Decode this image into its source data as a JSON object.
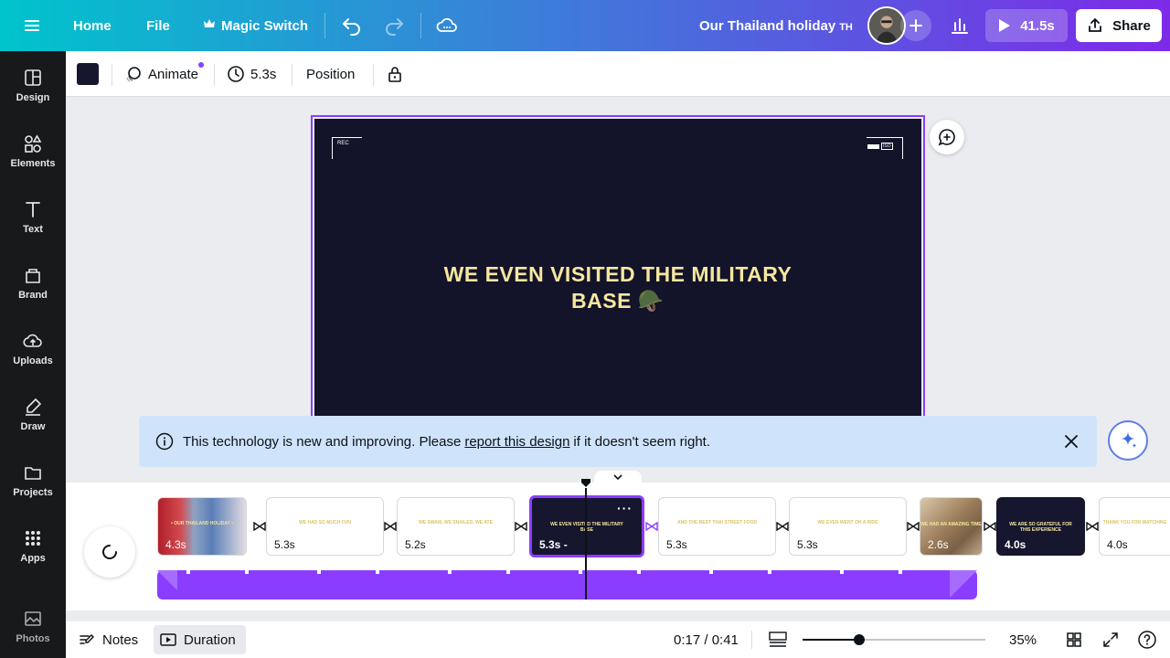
{
  "topbar": {
    "home_label": "Home",
    "file_label": "File",
    "magic_switch_label": "Magic Switch",
    "doc_title": "Our Thailand holiday",
    "doc_title_suffix": "TH",
    "play_label": "41.5s",
    "share_label": "Share"
  },
  "sidebar": {
    "items": [
      {
        "label": "Design",
        "icon": "design-icon"
      },
      {
        "label": "Elements",
        "icon": "elements-icon"
      },
      {
        "label": "Text",
        "icon": "text-icon"
      },
      {
        "label": "Brand",
        "icon": "brand-icon"
      },
      {
        "label": "Uploads",
        "icon": "uploads-icon"
      },
      {
        "label": "Draw",
        "icon": "draw-icon"
      },
      {
        "label": "Projects",
        "icon": "projects-icon"
      },
      {
        "label": "Apps",
        "icon": "apps-icon"
      },
      {
        "label": "Photos",
        "icon": "photos-icon"
      }
    ]
  },
  "context_toolbar": {
    "color_swatch": "#16172e",
    "animate_label": "Animate",
    "duration_label": "5.3s",
    "position_label": "Position"
  },
  "canvas": {
    "rec_label": "REC",
    "iso_label": "ISO",
    "slide_text_line1": "WE EVEN VISITED THE MILITARY",
    "slide_text_line2": "BASE 🪖",
    "text_color": "#f5e79e",
    "bg_color": "#13132a"
  },
  "banner": {
    "text_before": "This technology is new and improving. Please",
    "link_text": "report this design",
    "text_after": "if it doesn't seem right."
  },
  "timeline": {
    "pages": [
      {
        "duration": "4.3s",
        "mini": "• OUR THAILAND HOLIDAY •"
      },
      {
        "duration": "5.3s",
        "mini": "WE HAD SO MUCH FUN"
      },
      {
        "duration": "5.2s",
        "mini": "WE SWAM, WE SNAILED, WE ATE"
      },
      {
        "duration": "5.3s -",
        "mini": "WE EVEN VISITED THE MILITARY BASE"
      },
      {
        "duration": "5.3s",
        "mini": "AND THE BEST THAI STREET FOOD"
      },
      {
        "duration": "5.3s",
        "mini": "WE EVEN WENT ON A RIDE"
      },
      {
        "duration": "2.6s",
        "mini": "WE HAD AN AMAZING TIME"
      },
      {
        "duration": "4.0s",
        "mini": "WE ARE SO GRATEFUL FOR THIS EXPERIENCE"
      },
      {
        "duration": "4.0s",
        "mini": "THANK YOU FOR WATCHING"
      }
    ]
  },
  "bottombar": {
    "notes_label": "Notes",
    "duration_label": "Duration",
    "time_label": "0:17 / 0:41",
    "zoom_label": "35%",
    "zoom_fraction": 0.31
  },
  "colors": {
    "accent": "#8b3dff",
    "banner_bg": "#cfe3fb",
    "sidebar_bg": "#18191b"
  }
}
